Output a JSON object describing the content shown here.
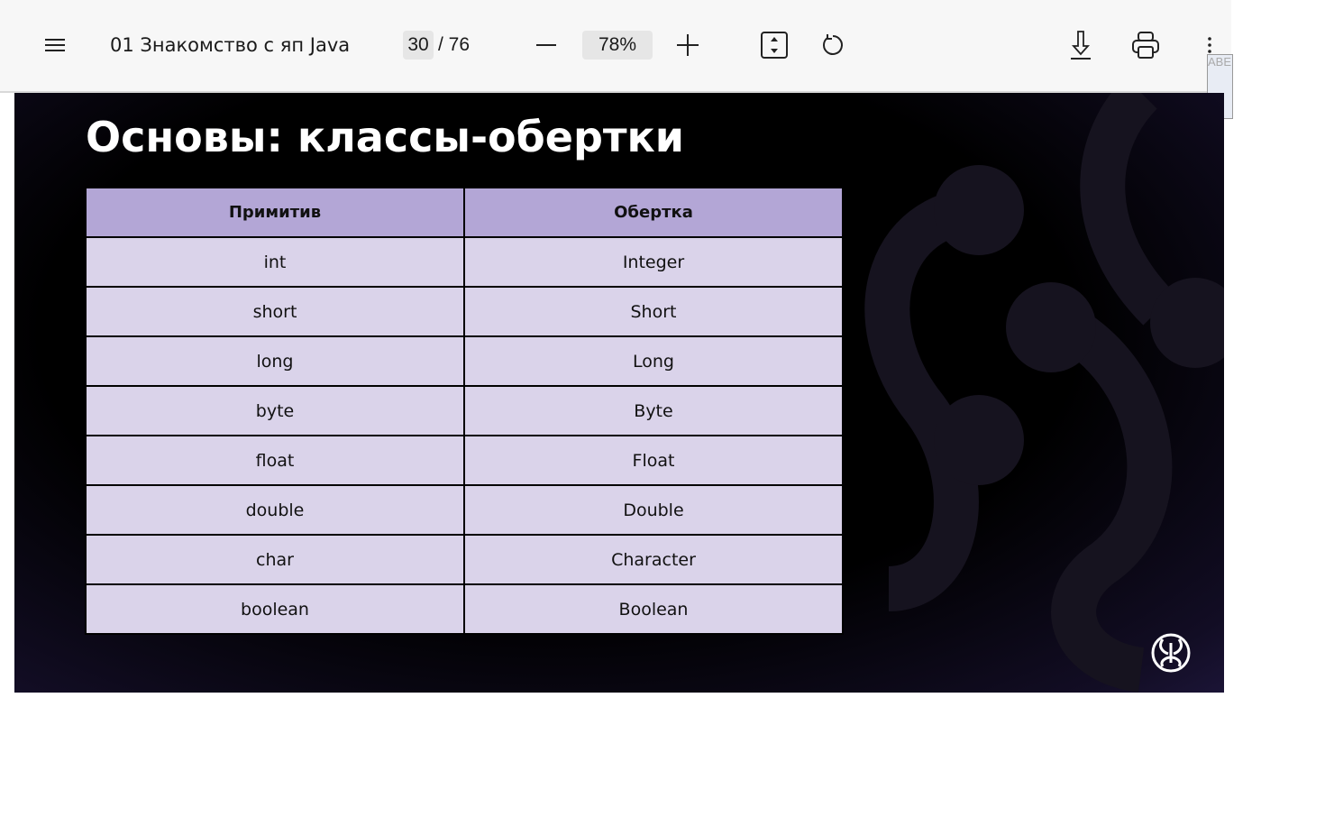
{
  "toolbar": {
    "title": "01 Знакомство с яп Java",
    "page_current": "30",
    "page_total": "/ 76",
    "zoom": "78%"
  },
  "slide": {
    "title": "Основы: классы-обертки",
    "headers": [
      "Примитив",
      "Обертка"
    ],
    "rows": [
      [
        "int",
        "Integer"
      ],
      [
        "short",
        "Short"
      ],
      [
        "long",
        "Long"
      ],
      [
        "byte",
        "Byte"
      ],
      [
        "float",
        "Float"
      ],
      [
        "double",
        "Double"
      ],
      [
        "char",
        "Character"
      ],
      [
        "boolean",
        "Boolean"
      ]
    ]
  },
  "popup": {
    "text": "ABE"
  }
}
